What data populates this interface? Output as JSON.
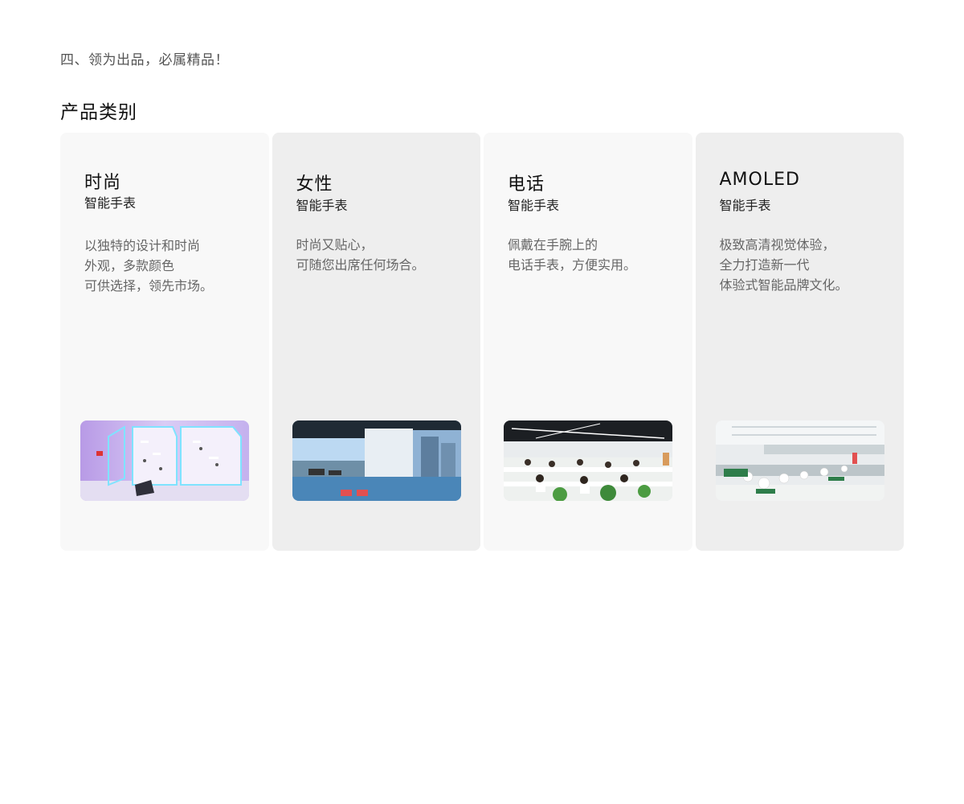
{
  "intro": "四、领为出品，必属精品！",
  "section_title": "产品类别",
  "cards": [
    {
      "title": "时尚",
      "subtitle": "智能手表",
      "lines": [
        "以独特的设计和时尚",
        "外观，多款颜色",
        "可供选择，领先市场。"
      ],
      "photo": "showroom-photo"
    },
    {
      "title": "女性",
      "subtitle": "智能手表",
      "lines": [
        "时尚又贴心，",
        "可随您出席任何场合。"
      ],
      "photo": "gym-photo"
    },
    {
      "title": "电话",
      "subtitle": "智能手表",
      "lines": [
        "佩戴在手腕上的",
        "电话手表，方便实用。"
      ],
      "photo": "office-photo"
    },
    {
      "title": "AMOLED",
      "subtitle": "智能手表",
      "lines": [
        "极致高清视觉体验，",
        "全力打造新一代",
        "体验式智能品牌文化。"
      ],
      "photo": "factory-photo"
    }
  ],
  "colors": {
    "card_light": "#f8f8f8",
    "card_dark": "#eeeeee"
  }
}
